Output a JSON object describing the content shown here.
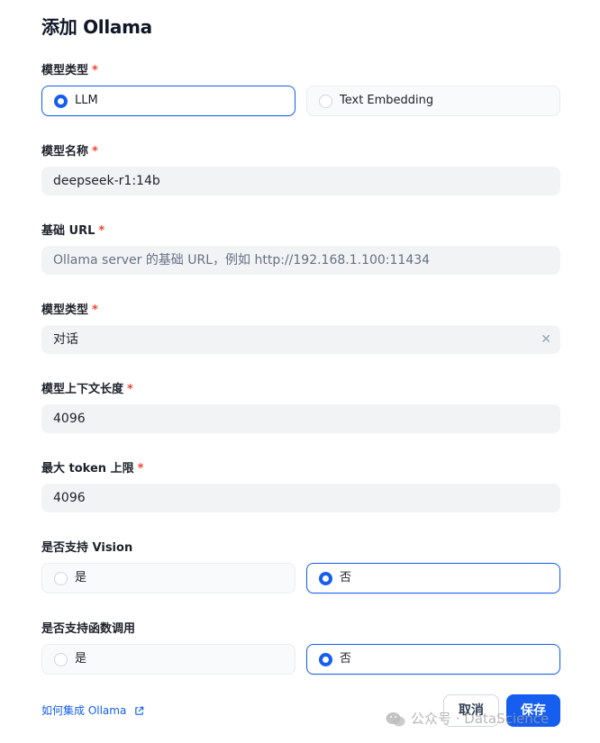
{
  "dialog": {
    "title": "添加 Ollama"
  },
  "model_type": {
    "label": "模型类型",
    "required": "*",
    "options": [
      "LLM",
      "Text Embedding"
    ],
    "selected": "LLM"
  },
  "model_name": {
    "label": "模型名称",
    "required": "*",
    "value": "deepseek-r1:14b"
  },
  "base_url": {
    "label": "基础 URL",
    "required": "*",
    "placeholder": "Ollama server 的基础 URL，例如 http://192.168.1.100:11434"
  },
  "completion_type": {
    "label": "模型类型",
    "required": "*",
    "value": "对话",
    "clear_icon": "✕"
  },
  "context_length": {
    "label": "模型上下文长度",
    "required": "*",
    "value": "4096"
  },
  "max_tokens": {
    "label": "最大 token 上限",
    "required": "*",
    "value": "4096"
  },
  "vision_support": {
    "label": "是否支持 Vision",
    "options": [
      "是",
      "否"
    ],
    "selected": "否"
  },
  "function_call_support": {
    "label": "是否支持函数调用",
    "options": [
      "是",
      "否"
    ],
    "selected": "否"
  },
  "footer": {
    "help_link": "如何集成 Ollama",
    "cancel_label": "取消",
    "save_label": "保存"
  },
  "watermark": {
    "text": "公众号 · DataScience"
  },
  "colors": {
    "accent": "#155eef",
    "required": "#f04438",
    "field_bg": "#f2f3f5"
  }
}
